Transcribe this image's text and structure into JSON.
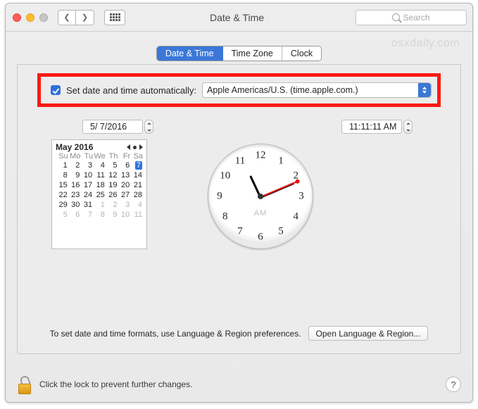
{
  "titlebar": {
    "title": "Date & Time",
    "search_placeholder": "Search"
  },
  "watermark": "osxdaily.com",
  "tabs": {
    "date_time": "Date & Time",
    "time_zone": "Time Zone",
    "clock": "Clock"
  },
  "auto": {
    "label": "Set date and time automatically:",
    "server": "Apple Americas/U.S. (time.apple.com.)"
  },
  "date_field": "5/  7/2016",
  "time_field": "11:11:11 AM",
  "calendar": {
    "title": "May 2016",
    "dow": [
      "Su",
      "Mo",
      "Tu",
      "We",
      "Th",
      "Fr",
      "Sa"
    ],
    "weeks": [
      [
        {
          "d": "1"
        },
        {
          "d": "2"
        },
        {
          "d": "3"
        },
        {
          "d": "4"
        },
        {
          "d": "5"
        },
        {
          "d": "6"
        },
        {
          "d": "7",
          "sel": true
        }
      ],
      [
        {
          "d": "8"
        },
        {
          "d": "9"
        },
        {
          "d": "10"
        },
        {
          "d": "11"
        },
        {
          "d": "12"
        },
        {
          "d": "13"
        },
        {
          "d": "14"
        }
      ],
      [
        {
          "d": "15"
        },
        {
          "d": "16"
        },
        {
          "d": "17"
        },
        {
          "d": "18"
        },
        {
          "d": "19"
        },
        {
          "d": "20"
        },
        {
          "d": "21"
        }
      ],
      [
        {
          "d": "22"
        },
        {
          "d": "23"
        },
        {
          "d": "24"
        },
        {
          "d": "25"
        },
        {
          "d": "26"
        },
        {
          "d": "27"
        },
        {
          "d": "28"
        }
      ],
      [
        {
          "d": "29"
        },
        {
          "d": "30"
        },
        {
          "d": "31"
        },
        {
          "d": "1",
          "o": true
        },
        {
          "d": "2",
          "o": true
        },
        {
          "d": "3",
          "o": true
        },
        {
          "d": "4",
          "o": true
        }
      ],
      [
        {
          "d": "5",
          "o": true
        },
        {
          "d": "6",
          "o": true
        },
        {
          "d": "7",
          "o": true
        },
        {
          "d": "8",
          "o": true
        },
        {
          "d": "9",
          "o": true
        },
        {
          "d": "10",
          "o": true
        },
        {
          "d": "11",
          "o": true
        }
      ]
    ]
  },
  "clock": {
    "numbers": [
      "12",
      "1",
      "2",
      "3",
      "4",
      "5",
      "6",
      "7",
      "8",
      "9",
      "10",
      "11"
    ],
    "ampm": "AM",
    "hour_deg": 335,
    "min_deg": 67,
    "sec_deg": 67
  },
  "hint": "To set date and time formats, use Language & Region preferences.",
  "open_btn": "Open Language & Region...",
  "lock_hint": "Click the lock to prevent further changes.",
  "help": "?"
}
